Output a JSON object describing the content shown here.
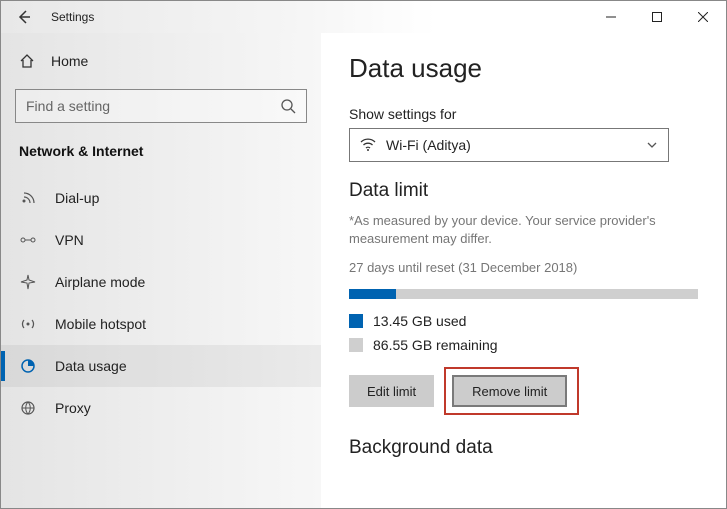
{
  "titlebar": {
    "title": "Settings"
  },
  "sidebar": {
    "home": "Home",
    "search_placeholder": "Find a setting",
    "group": "Network & Internet",
    "items": [
      {
        "label": "Dial-up"
      },
      {
        "label": "VPN"
      },
      {
        "label": "Airplane mode"
      },
      {
        "label": "Mobile hotspot"
      },
      {
        "label": "Data usage"
      },
      {
        "label": "Proxy"
      }
    ]
  },
  "content": {
    "title": "Data usage",
    "show_settings_label": "Show settings for",
    "network_selected": "Wi-Fi (Aditya)",
    "section_limit": "Data limit",
    "note": "*As measured by your device. Your service provider's measurement may differ.",
    "reset_text": "27 days until reset (31 December 2018)",
    "used_label": "13.45 GB used",
    "remaining_label": "86.55 GB remaining",
    "progress_percent": 13.45,
    "edit_label": "Edit limit",
    "remove_label": "Remove limit",
    "section_bg": "Background data",
    "colors": {
      "accent": "#0063b1",
      "bar_bg": "#cfcfcf",
      "swatch_gray": "#cfcfcf"
    }
  }
}
